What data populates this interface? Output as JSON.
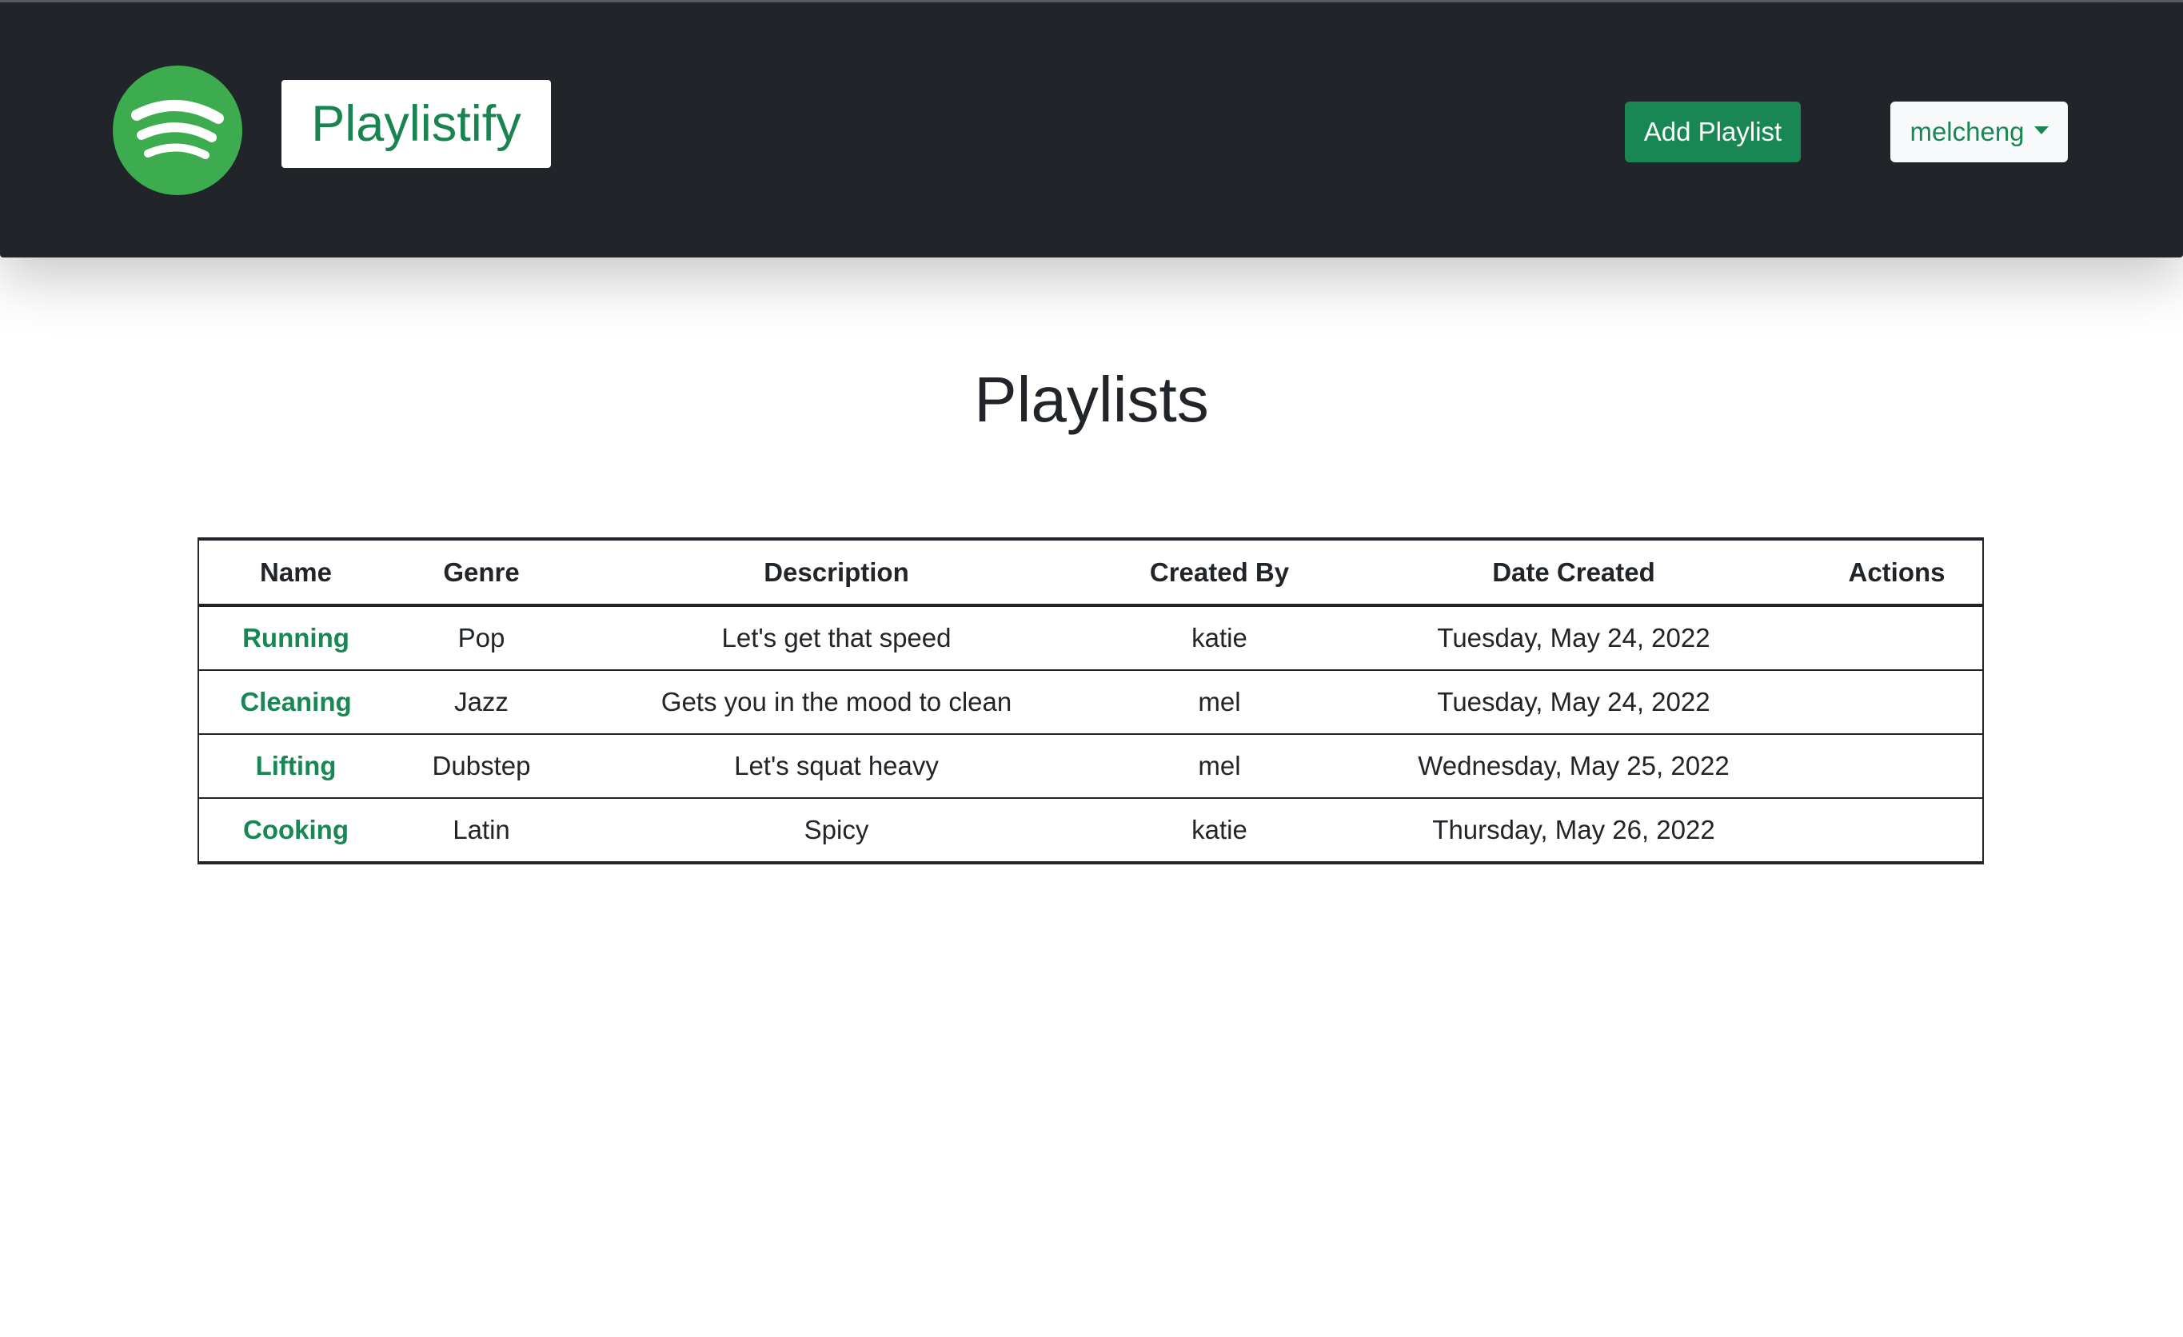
{
  "header": {
    "brand": "Playlistify",
    "logo_icon": "spotify-logo-icon",
    "add_button_label": "Add Playlist",
    "user_menu_label": "melcheng",
    "accent_color": "#198754",
    "navbar_color": "#212529"
  },
  "main": {
    "title": "Playlists",
    "table": {
      "headers": {
        "name": "Name",
        "genre": "Genre",
        "description": "Description",
        "created_by": "Created By",
        "date_created": "Date Created",
        "actions": "Actions"
      },
      "rows": [
        {
          "name": "Running",
          "genre": "Pop",
          "description": "Let's get that speed",
          "created_by": "katie",
          "date_created": "Tuesday, May 24, 2022",
          "actions": ""
        },
        {
          "name": "Cleaning",
          "genre": "Jazz",
          "description": "Gets you in the mood to clean",
          "created_by": "mel",
          "date_created": "Tuesday, May 24, 2022",
          "actions": ""
        },
        {
          "name": "Lifting",
          "genre": "Dubstep",
          "description": "Let's squat heavy",
          "created_by": "mel",
          "date_created": "Wednesday, May 25, 2022",
          "actions": ""
        },
        {
          "name": "Cooking",
          "genre": "Latin",
          "description": "Spicy",
          "created_by": "katie",
          "date_created": "Thursday, May 26, 2022",
          "actions": ""
        }
      ]
    }
  }
}
